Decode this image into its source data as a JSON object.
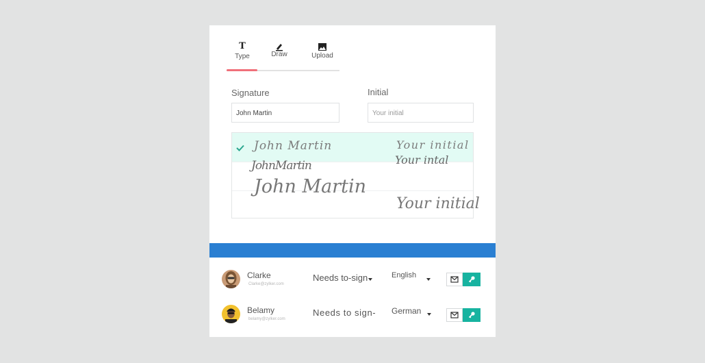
{
  "tabs": [
    {
      "label": "Type",
      "icon": "type-icon",
      "active": true
    },
    {
      "label": "Draw",
      "icon": "pen-icon"
    },
    {
      "label": "Upload",
      "icon": "image-icon"
    }
  ],
  "signature": {
    "label": "Signature",
    "value": "John Martin"
  },
  "initial": {
    "label": "Initial",
    "placeholder": "Your initial"
  },
  "signature_options": [
    {
      "signature": "John Martin",
      "initial": "Your initial",
      "selected": true
    },
    {
      "signature": "JohnMartin",
      "initial": "Your intal"
    },
    {
      "signature": "John Martin",
      "initial": "Your initial"
    }
  ],
  "recipients": [
    {
      "name": "Clarke",
      "email": "Clarke@zylker.com",
      "role": "Needs to-sign",
      "language": "English"
    },
    {
      "name": "Belamy",
      "email": "belamy@zylker.com",
      "role": "Needs to sign-",
      "language": "German"
    }
  ],
  "colors": {
    "accent_tab": "#f0707a",
    "selected_row": "#e2fbf4",
    "bar": "#2a7fd2",
    "key_button": "#17b3a0"
  }
}
